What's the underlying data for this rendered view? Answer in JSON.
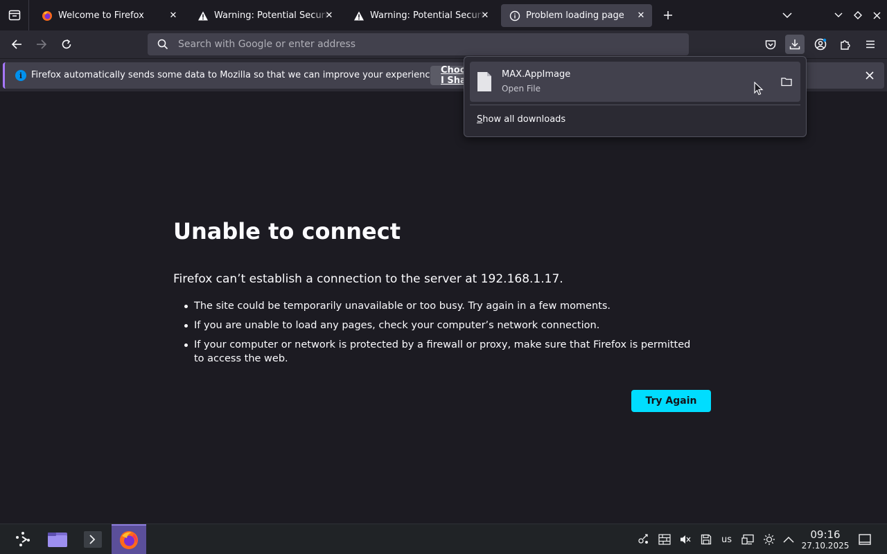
{
  "tabs": [
    {
      "title": "Welcome to Firefox",
      "icon": "firefox-icon",
      "active": false
    },
    {
      "title": "Warning: Potential Security Risk Ahead",
      "icon": "warning-icon",
      "active": false
    },
    {
      "title": "Warning: Potential Security Risk Ahead",
      "icon": "warning-icon",
      "active": false
    },
    {
      "title": "Problem loading page",
      "icon": "info-icon",
      "active": true
    }
  ],
  "navbar": {
    "url_placeholder": "Search with Google or enter address",
    "url_value": ""
  },
  "notification": {
    "text": "Firefox automatically sends some data to Mozilla so that we can improve your experience.",
    "button_label": "Choose What I Share"
  },
  "downloads_panel": {
    "file_name": "MAX.AppImage",
    "file_status": "Open File",
    "show_all_first": "S",
    "show_all_rest": "how all downloads"
  },
  "error_page": {
    "title": "Unable to connect",
    "description": "Firefox can’t establish a connection to the server at 192.168.1.17.",
    "bullets": [
      "The site could be temporarily unavailable or too busy. Try again in a few moments.",
      "If you are unable to load any pages, check your computer’s network connection.",
      "If your computer or network is protected by a firewall or proxy, make sure that Firefox is permitted to access the web."
    ],
    "try_again_label": "Try Again"
  },
  "taskbar": {
    "keyboard_layout": "us",
    "time": "09:16",
    "date": "27.10.2025"
  },
  "colors": {
    "accent_button": "#00ddff",
    "page_background": "#1c1b22",
    "toolbar": "#2b2a33",
    "active_task": "#5b4f9a"
  }
}
